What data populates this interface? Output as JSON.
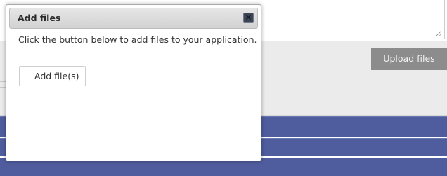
{
  "dialog": {
    "title": "Add files",
    "instruction": "Click the button below to add files to your application.",
    "add_button_label": "Add file(s)",
    "close_glyph": "✕"
  },
  "page": {
    "upload_button_label": "Upload files"
  },
  "icons": {
    "close": "close-icon",
    "add_file": "file-icon",
    "resize": "resize-grip-icon"
  },
  "colors": {
    "band": "#4f5d9e",
    "upload_button": "#8c8c8c",
    "panel": "#ebebeb",
    "close_button": "#3d4554"
  }
}
